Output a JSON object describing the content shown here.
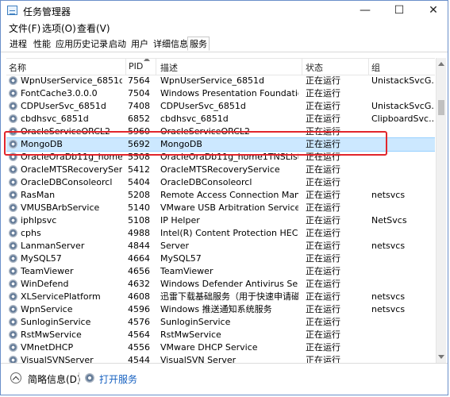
{
  "window": {
    "title": "任务管理器",
    "controls": {
      "minimize": "—",
      "maximize": "☐",
      "close": "✕"
    }
  },
  "menu": [
    "文件(F)",
    "选项(O)",
    "查看(V)"
  ],
  "tabs": [
    {
      "label": "进程"
    },
    {
      "label": "性能"
    },
    {
      "label": "应用历史记录"
    },
    {
      "label": "启动"
    },
    {
      "label": "用户"
    },
    {
      "label": "详细信息"
    },
    {
      "label": "服务",
      "active": true
    }
  ],
  "table": {
    "columns": [
      "名称",
      "PID",
      "描述",
      "状态",
      "组"
    ],
    "rows": [
      {
        "name": "WpnUserService_6851d",
        "pid": "7564",
        "desc": "WpnUserService_6851d",
        "status": "正在运行",
        "group": "UnistackSvcG..."
      },
      {
        "name": "FontCache3.0.0.0",
        "pid": "7504",
        "desc": "Windows Presentation Foundatio...",
        "status": "正在运行",
        "group": ""
      },
      {
        "name": "CDPUserSvc_6851d",
        "pid": "7408",
        "desc": "CDPUserSvc_6851d",
        "status": "正在运行",
        "group": "UnistackSvcG..."
      },
      {
        "name": "cbdhsvc_6851d",
        "pid": "6852",
        "desc": "cbdhsvc_6851d",
        "status": "正在运行",
        "group": "ClipboardSvc..."
      },
      {
        "name": "OracleServiceORCL2",
        "pid": "5960",
        "desc": "OracleServiceORCL2",
        "status": "正在运行",
        "group": ""
      },
      {
        "name": "MongoDB",
        "pid": "5692",
        "desc": "MongoDB",
        "status": "正在运行",
        "group": "",
        "selected": true
      },
      {
        "name": "OracleOraDb11g_home1TNSList...",
        "pid": "5508",
        "desc": "OracleOraDb11g_home1TNSListe...",
        "status": "正在运行",
        "group": ""
      },
      {
        "name": "OracleMTSRecoveryServ...",
        "pid": "5412",
        "desc": "OracleMTSRecoveryService",
        "status": "正在运行",
        "group": ""
      },
      {
        "name": "OracleDBConsoleorcl",
        "pid": "5404",
        "desc": "OracleDBConsoleorcl",
        "status": "正在运行",
        "group": ""
      },
      {
        "name": "RasMan",
        "pid": "5208",
        "desc": "Remote Access Connection Mana...",
        "status": "正在运行",
        "group": "netsvcs"
      },
      {
        "name": "VMUSBArbService",
        "pid": "5140",
        "desc": "VMware USB Arbitration Service",
        "status": "正在运行",
        "group": ""
      },
      {
        "name": "iphlpsvc",
        "pid": "5108",
        "desc": "IP Helper",
        "status": "正在运行",
        "group": "NetSvcs"
      },
      {
        "name": "cphs",
        "pid": "4988",
        "desc": "Intel(R) Content Protection HECI S...",
        "status": "正在运行",
        "group": ""
      },
      {
        "name": "LanmanServer",
        "pid": "4844",
        "desc": "Server",
        "status": "正在运行",
        "group": "netsvcs"
      },
      {
        "name": "MySQL57",
        "pid": "4664",
        "desc": "MySQL57",
        "status": "正在运行",
        "group": ""
      },
      {
        "name": "TeamViewer",
        "pid": "4656",
        "desc": "TeamViewer",
        "status": "正在运行",
        "group": ""
      },
      {
        "name": "WinDefend",
        "pid": "4632",
        "desc": "Windows Defender Antivirus Servi...",
        "status": "正在运行",
        "group": ""
      },
      {
        "name": "XLServicePlatform",
        "pid": "4608",
        "desc": "迅雷下载基础服务（用于快速申请磁...",
        "status": "正在运行",
        "group": "netsvcs"
      },
      {
        "name": "WpnService",
        "pid": "4596",
        "desc": "Windows 推送通知系统服务",
        "status": "正在运行",
        "group": "netsvcs"
      },
      {
        "name": "SunloginService",
        "pid": "4576",
        "desc": "SunloginService",
        "status": "正在运行",
        "group": ""
      },
      {
        "name": "RstMwService",
        "pid": "4564",
        "desc": "RstMwService",
        "status": "正在运行",
        "group": ""
      },
      {
        "name": "VMnetDHCP",
        "pid": "4556",
        "desc": "VMware DHCP Service",
        "status": "正在运行",
        "group": ""
      },
      {
        "name": "VisualSVNServer",
        "pid": "4544",
        "desc": "VisualSVN Server",
        "status": "正在运行",
        "group": ""
      }
    ]
  },
  "footer": {
    "less_details": "简略信息(D)",
    "open_services": "打开服务"
  }
}
